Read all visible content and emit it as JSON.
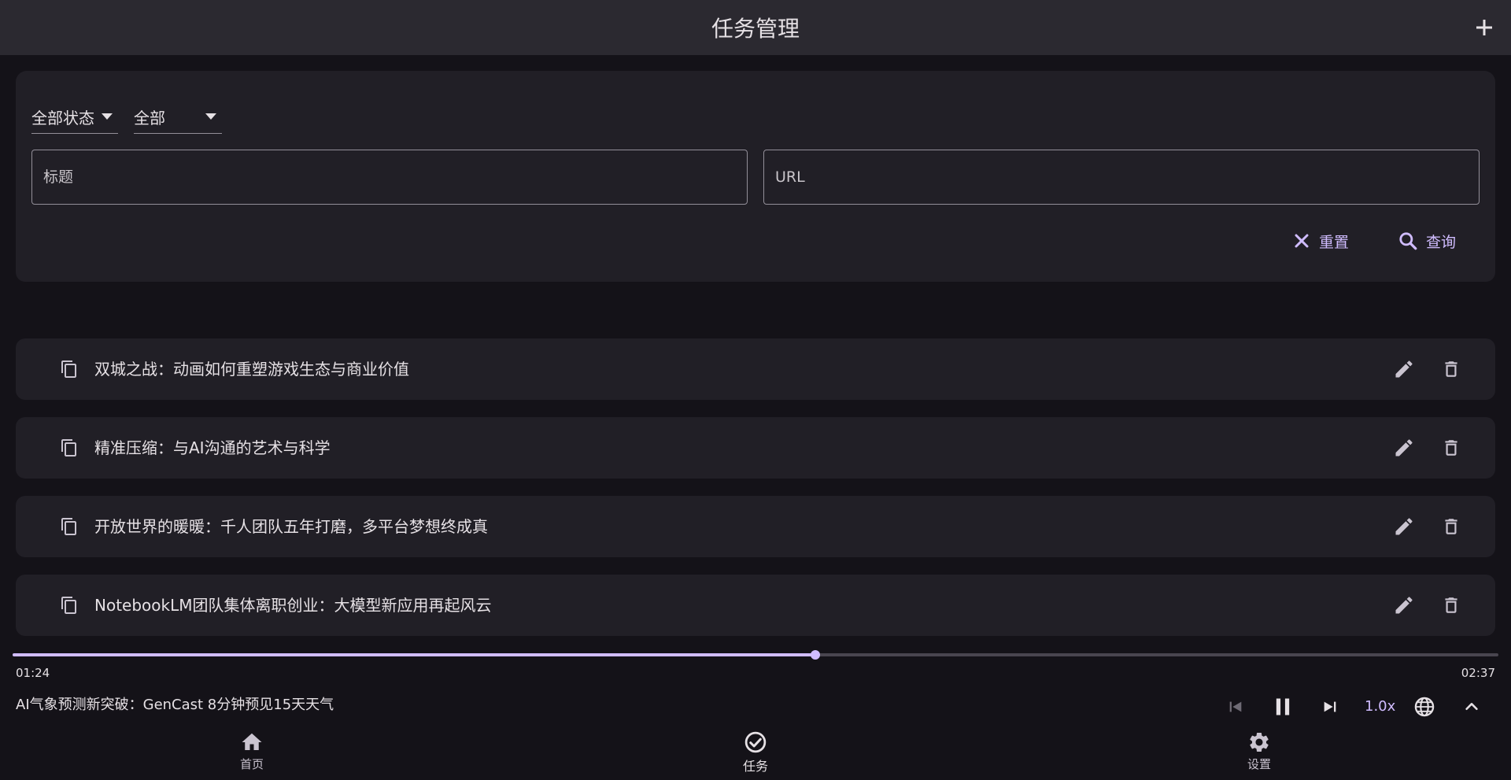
{
  "appbar": {
    "title": "任务管理",
    "add_icon": "plus-icon"
  },
  "filters": {
    "status_select": "全部状态",
    "type_select": "全部",
    "title_placeholder": "标题",
    "url_placeholder": "URL",
    "reset_label": "重置",
    "search_label": "查询"
  },
  "tasks": [
    {
      "title": ""
    },
    {
      "title": "双城之战：动画如何重塑游戏生态与商业价值"
    },
    {
      "title": "精准压缩：与AI沟通的艺术与科学"
    },
    {
      "title": "开放世界的暖暖：千人团队五年打磨，多平台梦想终成真"
    },
    {
      "title": "NotebookLM团队集体离职创业：大模型新应用再起风云"
    }
  ],
  "player": {
    "current_time": "01:24",
    "total_time": "02:37",
    "progress_percent": 54,
    "now_playing": "AI气象预测新突破：GenCast 8分钟预见15天天气",
    "speed": "1.0x"
  },
  "nav": {
    "home": "首页",
    "tasks": "任务",
    "settings": "设置"
  },
  "colors": {
    "background": "#141218",
    "surface": "#211f26",
    "appbar": "#2b2930",
    "accent": "#d0bcff",
    "text": "#e6e1e5"
  }
}
